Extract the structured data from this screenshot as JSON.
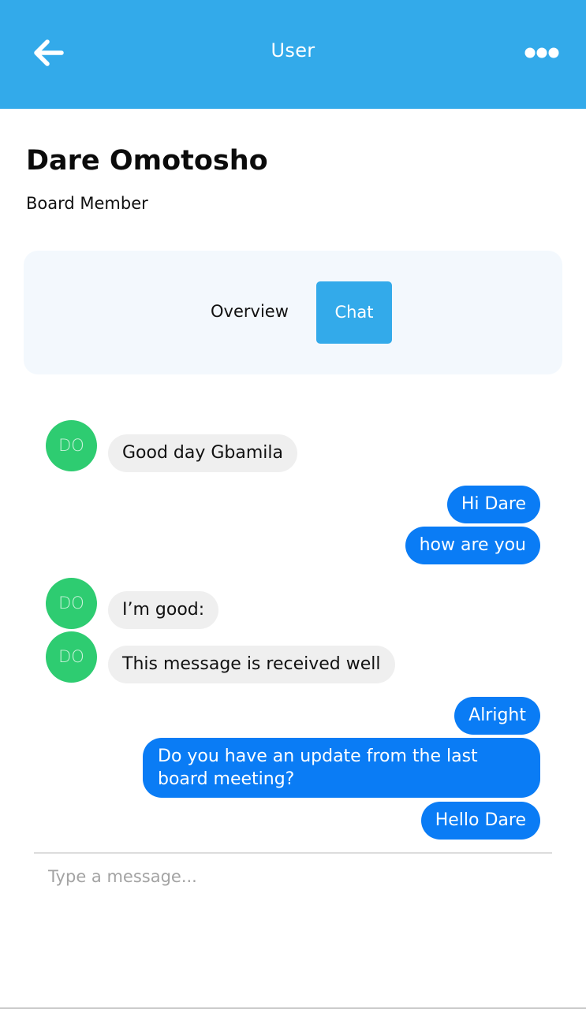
{
  "header": {
    "title": "User",
    "back_icon": "arrow-left-icon",
    "more_icon": "more-horizontal-icon",
    "background": "#33aaea"
  },
  "profile": {
    "name": "Dare Omotosho",
    "role": "Board Member"
  },
  "tabs": [
    {
      "label": "Overview",
      "active": false
    },
    {
      "label": "Chat",
      "active": true
    }
  ],
  "chat": {
    "avatar_initials": "DO",
    "messages": [
      {
        "from": "them",
        "text": "Good day Gbamila"
      },
      {
        "from": "me",
        "text": "Hi Dare"
      },
      {
        "from": "me",
        "text": "how are you"
      },
      {
        "from": "them",
        "text": "I’m good:"
      },
      {
        "from": "them",
        "text": "This message is received well"
      },
      {
        "from": "me",
        "text": "Alright"
      },
      {
        "from": "me",
        "text": "Do you have an update from the last board meeting?"
      },
      {
        "from": "me",
        "text": "Hello Dare"
      }
    ],
    "colors": {
      "incoming_bubble": "#efefef",
      "outgoing_bubble": "#0a7cf5",
      "avatar": "#2ecc71"
    }
  },
  "composer": {
    "placeholder": "Type a message..."
  }
}
